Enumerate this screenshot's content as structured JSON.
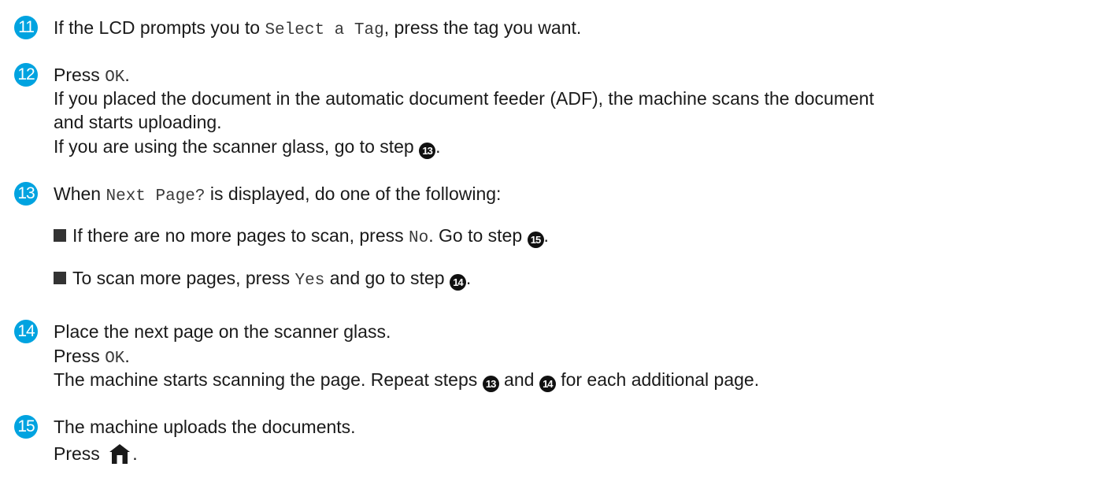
{
  "steps": [
    {
      "number": "11",
      "lines": [
        {
          "t1": "If the LCD prompts you to ",
          "code": "Select a Tag",
          "t2": ", press the tag you want."
        }
      ]
    },
    {
      "number": "12",
      "lines": [
        {
          "t1": "Press ",
          "code": "OK",
          "t2": "."
        },
        {
          "text": "If you placed the document in the automatic document feeder (ADF), the machine scans the document"
        },
        {
          "text": "and starts uploading."
        },
        {
          "t1": "If you are using the scanner glass, go to step ",
          "ref": "13",
          "t2": "."
        }
      ]
    },
    {
      "number": "13",
      "lines": [
        {
          "t1": "When ",
          "code": "Next Page?",
          "t2": " is displayed, do one of the following:"
        }
      ],
      "bullets": [
        {
          "t1": "If there are no more pages to scan, press ",
          "code": "No",
          "t2": ". Go to step ",
          "ref": "15",
          "t3": "."
        },
        {
          "t1": "To scan more pages, press ",
          "code": "Yes",
          "t2": " and go to step ",
          "ref": "14",
          "t3": "."
        }
      ]
    },
    {
      "number": "14",
      "lines": [
        {
          "text": "Place the next page on the scanner glass."
        },
        {
          "t1": "Press ",
          "code": "OK",
          "t2": "."
        },
        {
          "t1": "The machine starts scanning the page. Repeat steps ",
          "ref1": "13",
          "t2": " and ",
          "ref2": "14",
          "t3": " for each additional page."
        }
      ]
    },
    {
      "number": "15",
      "lines": [
        {
          "text": "The machine uploads the documents."
        },
        {
          "t1": "Press ",
          "t2": "."
        }
      ],
      "icon": "home-icon"
    }
  ],
  "colors": {
    "step_number_bg": "#00a3e0",
    "step_ref_bg": "#111111",
    "text": "#1a1a1a"
  }
}
